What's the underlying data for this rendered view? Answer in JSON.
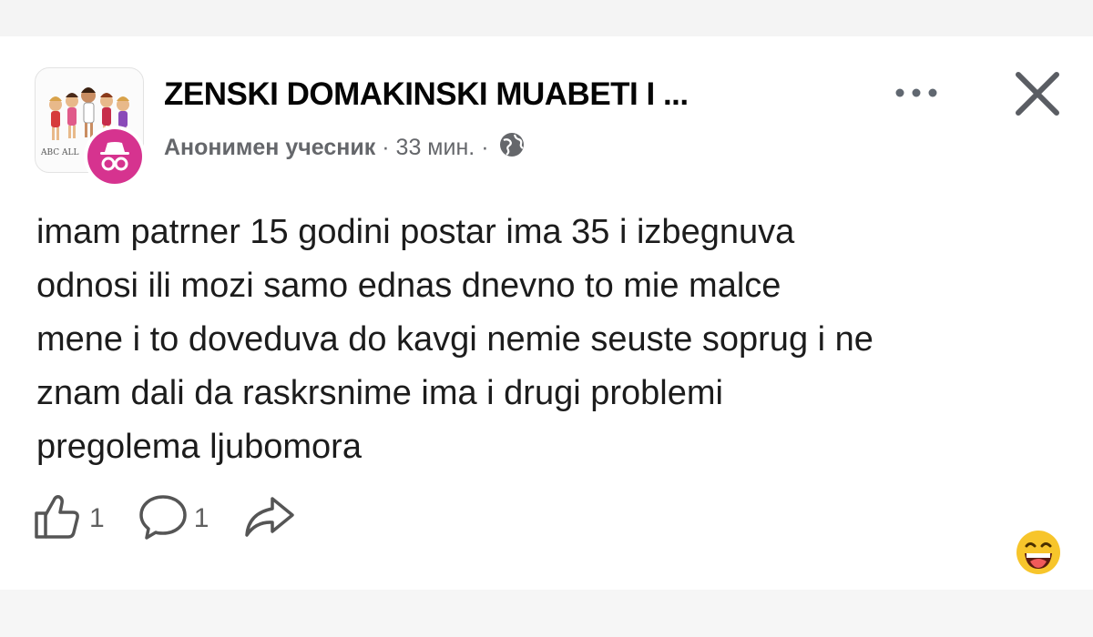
{
  "post": {
    "group_name": "ZENSKI DOMAKINSKI MUABETI I ...",
    "author": "Анонимен учесник",
    "separator": "·",
    "time": "33 мин.",
    "privacy_icon": "globe-icon",
    "group_avatar_caption": "ABC ALL",
    "lines": [
      "imam patrner 15 godini postar ima 35 i izbegnuva",
      "odnosi ili mozi samo ednas dnevno to mie malce",
      "mene i to doveduva do kavgi nemie seuste soprug i ne",
      "znam dali da raskrsnime ima i drugi problemi",
      "pregolema ljubomora"
    ]
  },
  "actions": {
    "like_count": "1",
    "comment_count": "1",
    "share_icon": "share-arrow-icon",
    "reaction_icon": "laughing-emoji-icon"
  },
  "colors": {
    "user_avatar": "#d6338f",
    "meta_text": "#65676b",
    "emoji_face": "#f7c52b"
  }
}
